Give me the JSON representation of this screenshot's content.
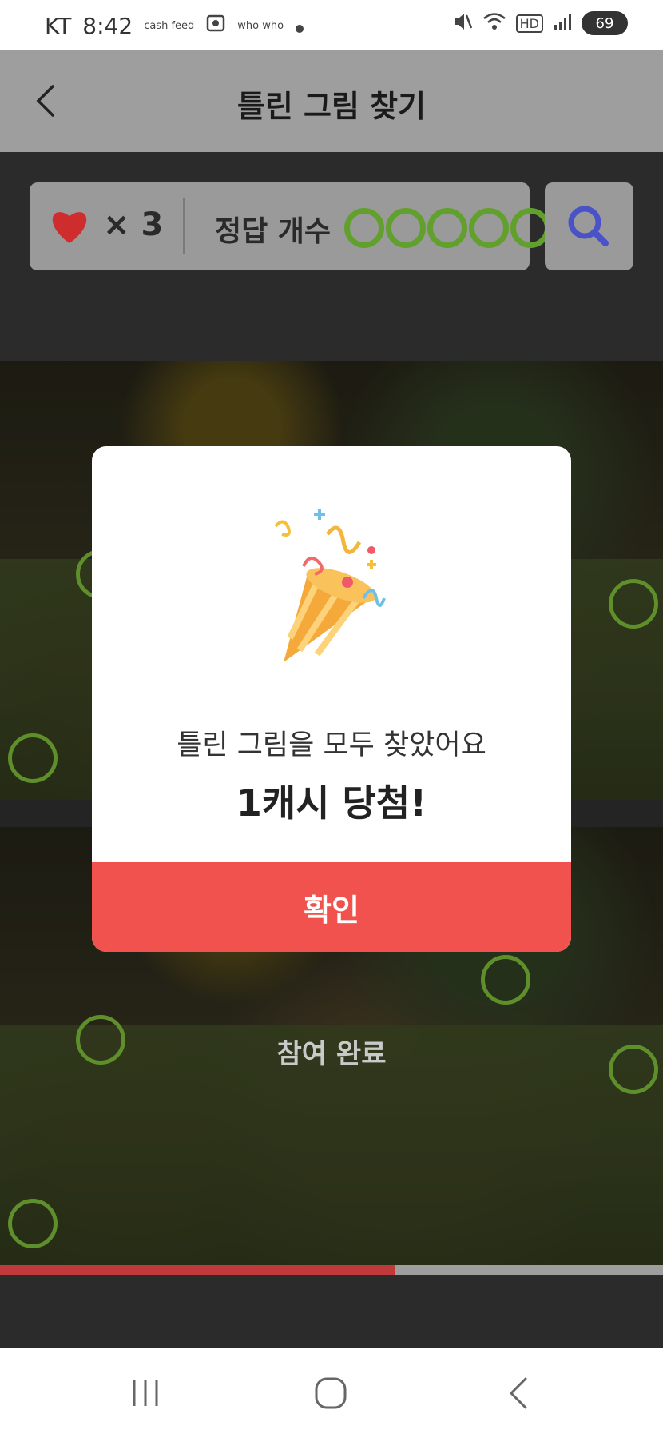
{
  "status_bar": {
    "carrier": "KT",
    "time": "8:42",
    "cashfeed_label": "cash feed",
    "whowho_label": "who who",
    "battery": "69",
    "hd_label": "HD"
  },
  "header": {
    "title": "틀린 그림 찾기"
  },
  "game_bar": {
    "lives_symbol": "×",
    "lives_count": "3",
    "answer_label": "정답 개수",
    "found_count": 5
  },
  "game": {
    "status_label": "참여 완료",
    "progress": 0.595
  },
  "modal": {
    "message": "틀린 그림을 모두 찾았어요",
    "prize": "1캐시 당첨!",
    "confirm_label": "확인"
  },
  "colors": {
    "accent_red": "#f2524d",
    "answer_green": "#62a02d",
    "progress_red": "#c0393b"
  }
}
